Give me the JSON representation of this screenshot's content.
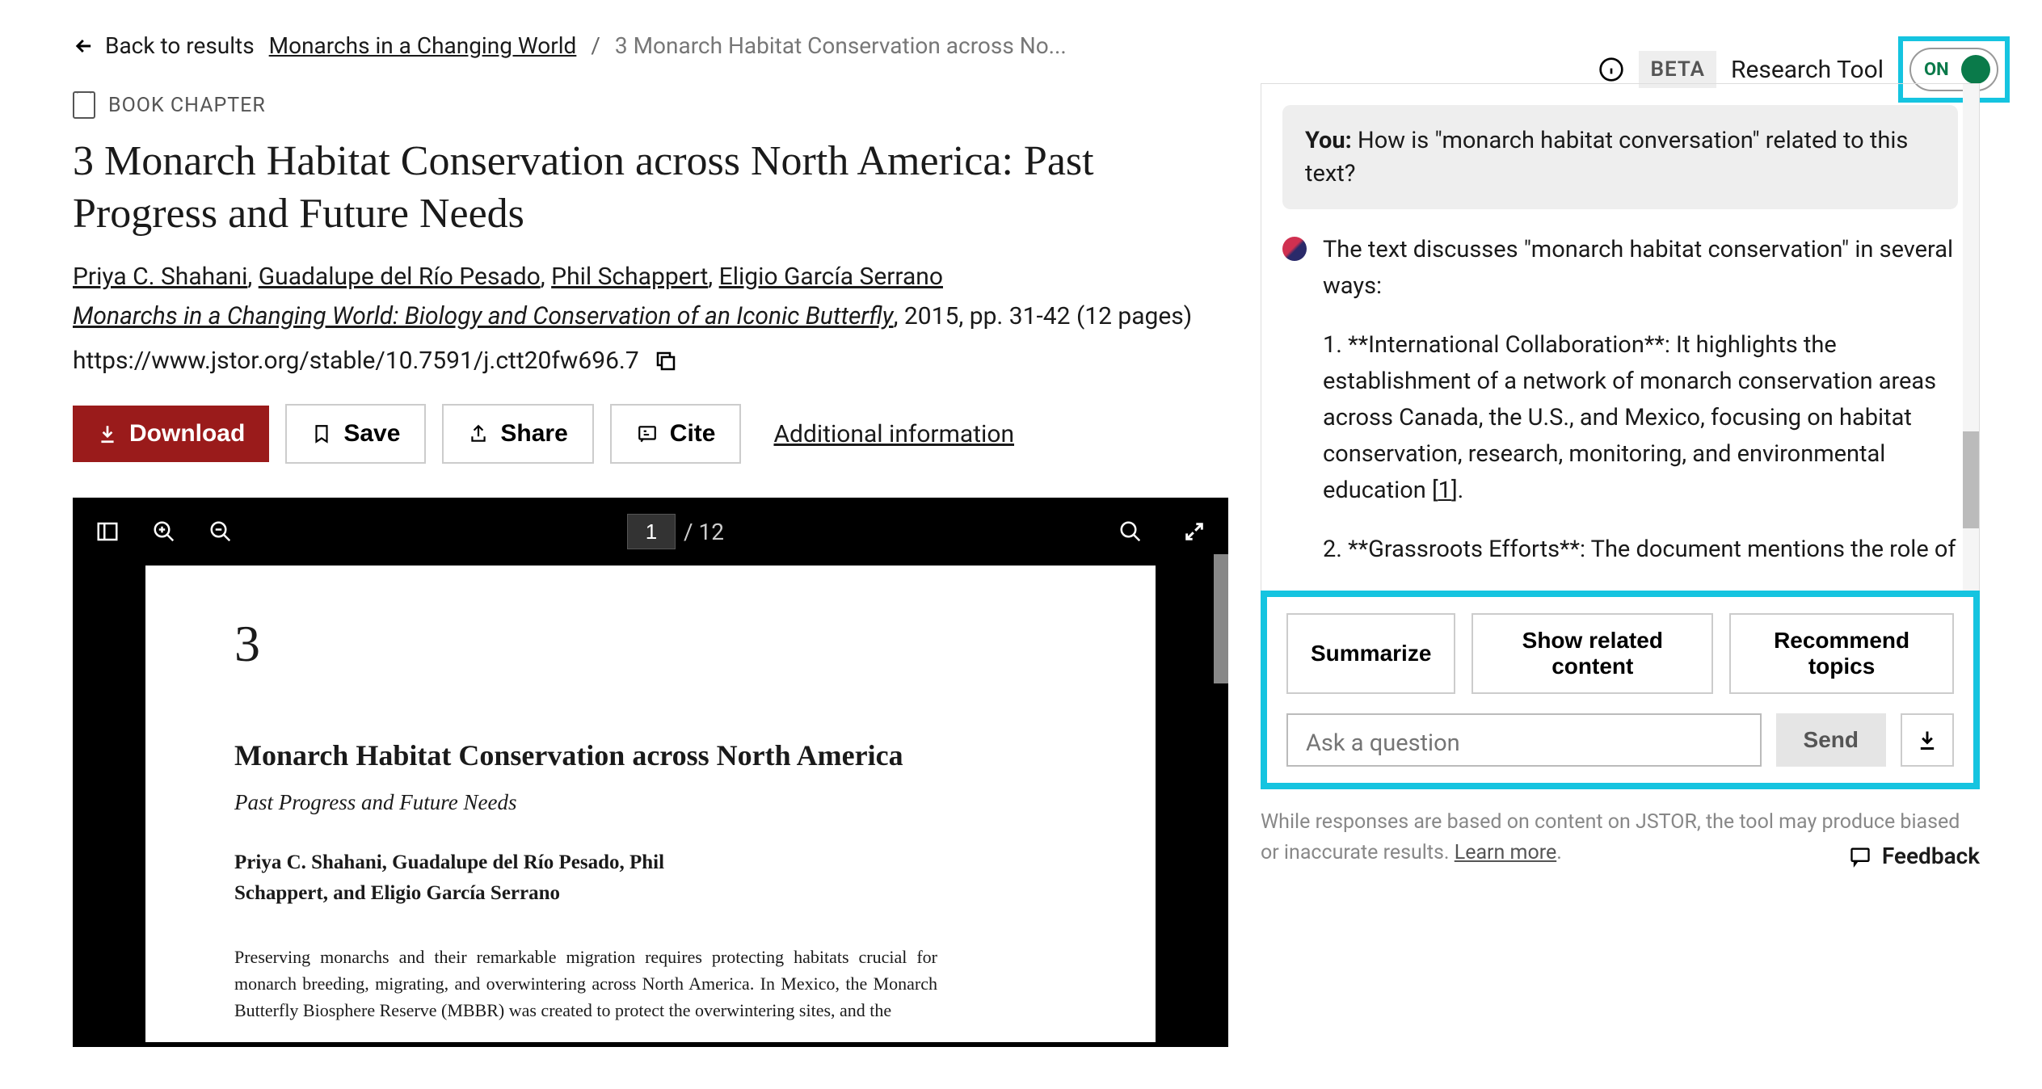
{
  "breadcrumb": {
    "back": "Back to results",
    "book": "Monarchs in a Changing World",
    "current": "3 Monarch Habitat Conservation across No..."
  },
  "tool_header": {
    "beta": "BETA",
    "label": "Research Tool",
    "toggle": "ON"
  },
  "doc": {
    "type": "BOOK CHAPTER",
    "title": "3 Monarch Habitat Conservation across North America: Past Progress and Future Needs",
    "authors": [
      "Priya C. Shahani",
      "Guadalupe del Río Pesado",
      "Phil Schappert",
      "Eligio García Serrano"
    ],
    "source_title": "Monarchs in a Changing World: Biology and Conservation of an Iconic Butterfly",
    "year": "2015",
    "pages": "pp. 31-42 (12 pages)",
    "url": "https://www.jstor.org/stable/10.7591/j.ctt20fw696.7"
  },
  "actions": {
    "download": "Download",
    "save": "Save",
    "share": "Share",
    "cite": "Cite",
    "additional": "Additional information"
  },
  "pdf": {
    "page_current": "1",
    "page_total": "/ 12",
    "page_num": "3",
    "title": "Monarch Habitat Conservation across North America",
    "subtitle": "Past Progress and Future Needs",
    "authors_line": "Priya C. Shahani, Guadalupe del Río Pesado, Phil Schappert, and Eligio García Serrano",
    "body": "Preserving monarchs and their remarkable migration requires protecting habitats crucial for monarch breeding, migrating, and overwintering across North America. In Mexico, the Monarch Butterfly Biosphere Reserve (MBBR) was created to protect the overwintering sites, and the"
  },
  "chat": {
    "user_prefix": "You:",
    "user_msg": "How is \"monarch habitat conversation\" related to this text?",
    "ai_intro": "The text discusses \"monarch habitat conservation\" in several ways:",
    "point1": "1. **International Collaboration**: It highlights the establishment of a network of monarch conservation areas across Canada, the U.S., and Mexico, focusing on habitat conservation, research, monitoring, and environmental education [",
    "cite1": "1",
    "point1_end": "].",
    "point2": "2. **Grassroots Efforts**: The document mentions the role of"
  },
  "chips": {
    "summarize": "Summarize",
    "related": "Show related content",
    "recommend": "Recommend topics"
  },
  "input": {
    "placeholder": "Ask a question",
    "send": "Send"
  },
  "disclaimer": {
    "text": "While responses are based on content on JSTOR, the tool may produce biased or inaccurate results. ",
    "learn": "Learn more"
  },
  "feedback": "Feedback"
}
